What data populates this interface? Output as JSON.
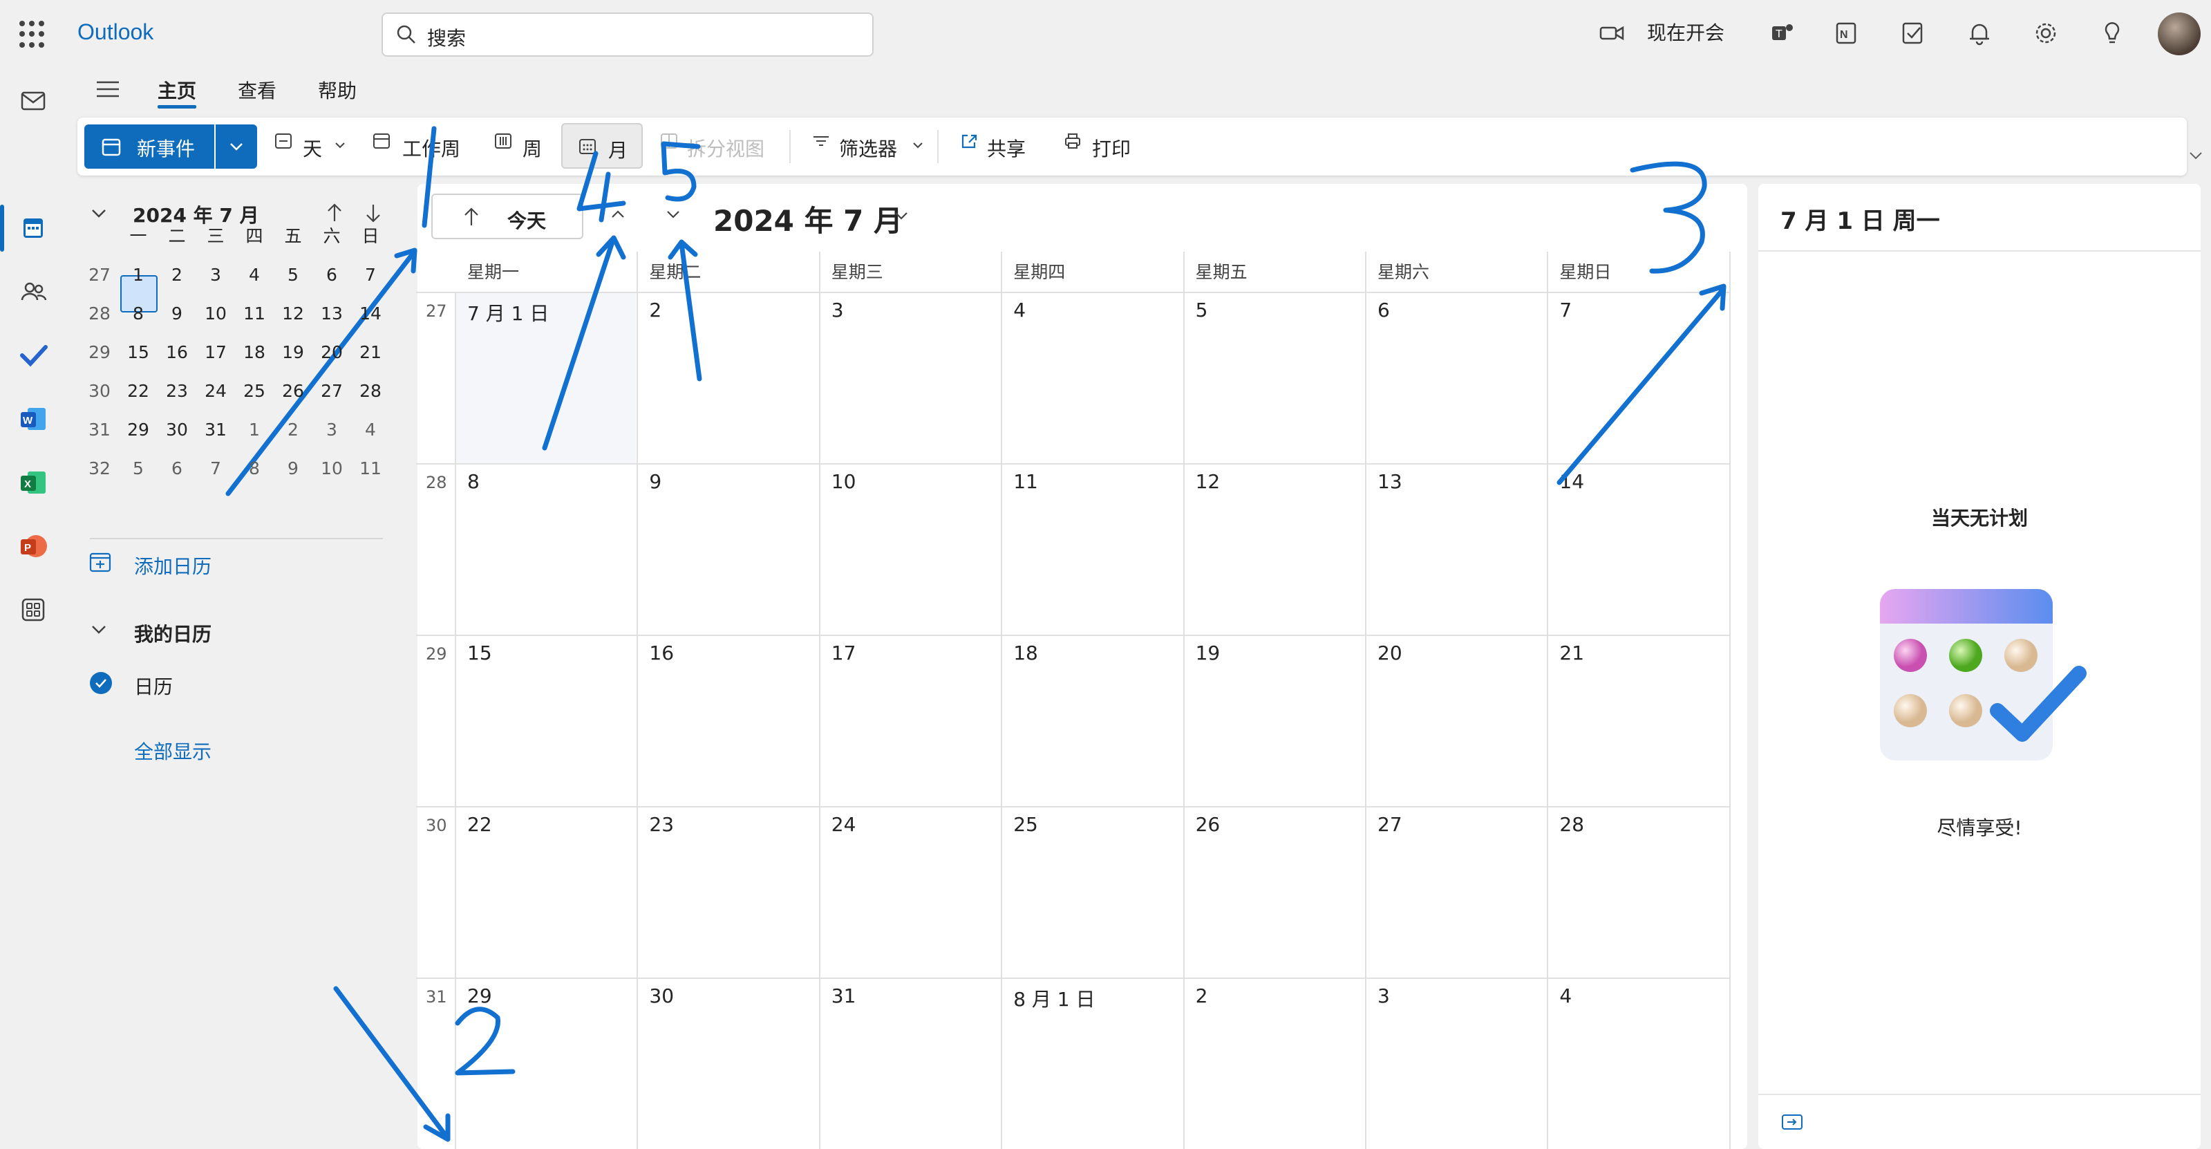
{
  "app": {
    "brand": "Outlook"
  },
  "search": {
    "placeholder": "搜索"
  },
  "topbar": {
    "meet_now": "现在开会"
  },
  "tabs": [
    "主页",
    "查看",
    "帮助"
  ],
  "ribbon": {
    "new_event": "新事件",
    "day": "天",
    "work_week": "工作周",
    "week": "周",
    "month": "月",
    "split_view": "拆分视图",
    "filter": "筛选器",
    "share": "共享",
    "print": "打印"
  },
  "mini_calendar": {
    "title": "2024 年 7 月",
    "weekdays": [
      "一",
      "二",
      "三",
      "四",
      "五",
      "六",
      "日"
    ],
    "weeks": [
      {
        "num": "27",
        "days": [
          "1",
          "2",
          "3",
          "4",
          "5",
          "6",
          "7"
        ]
      },
      {
        "num": "28",
        "days": [
          "8",
          "9",
          "10",
          "11",
          "12",
          "13",
          "14"
        ]
      },
      {
        "num": "29",
        "days": [
          "15",
          "16",
          "17",
          "18",
          "19",
          "20",
          "21"
        ]
      },
      {
        "num": "30",
        "days": [
          "22",
          "23",
          "24",
          "25",
          "26",
          "27",
          "28"
        ]
      },
      {
        "num": "31",
        "days": [
          "29",
          "30",
          "31",
          "1",
          "2",
          "3",
          "4"
        ]
      },
      {
        "num": "32",
        "days": [
          "5",
          "6",
          "7",
          "8",
          "9",
          "10",
          "11"
        ]
      }
    ]
  },
  "left_pane": {
    "add_calendar": "添加日历",
    "my_calendars": "我的日历",
    "calendar_name": "日历",
    "show_all": "全部显示"
  },
  "main": {
    "today": "今天",
    "title": "2024 年 7 月",
    "weekdays": [
      "星期一",
      "星期二",
      "星期三",
      "星期四",
      "星期五",
      "星期六",
      "星期日"
    ],
    "weeks": [
      {
        "num": "27",
        "days": [
          "7 月 1 日",
          "2",
          "3",
          "4",
          "5",
          "6",
          "7"
        ]
      },
      {
        "num": "28",
        "days": [
          "8",
          "9",
          "10",
          "11",
          "12",
          "13",
          "14"
        ]
      },
      {
        "num": "29",
        "days": [
          "15",
          "16",
          "17",
          "18",
          "19",
          "20",
          "21"
        ]
      },
      {
        "num": "30",
        "days": [
          "22",
          "23",
          "24",
          "25",
          "26",
          "27",
          "28"
        ]
      },
      {
        "num": "31",
        "days": [
          "29",
          "30",
          "31",
          "8 月 1 日",
          "2",
          "3",
          "4"
        ]
      }
    ]
  },
  "right_pane": {
    "title": "7 月 1 日 周一",
    "no_plans": "当天无计划",
    "enjoy": "尽情享受!"
  },
  "annotations": [
    "1",
    "2",
    "3",
    "4",
    "5"
  ],
  "colors": {
    "accent": "#0f6cbd",
    "annotation": "#1170d0"
  }
}
